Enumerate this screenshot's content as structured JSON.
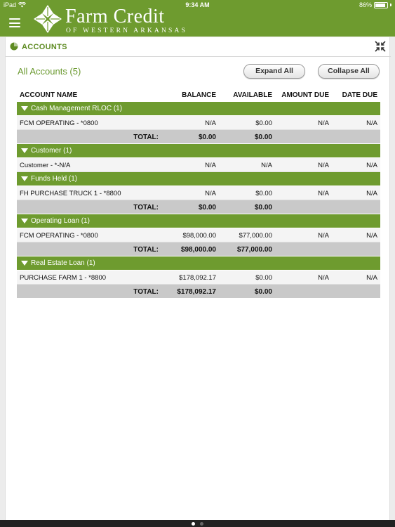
{
  "status_bar": {
    "device": "iPad",
    "time": "9:34 AM",
    "battery": "86%",
    "battery_level": 0.86
  },
  "brand": {
    "title": "Farm Credit",
    "subtitle": "OF WESTERN ARKANSAS"
  },
  "section": {
    "title": "ACCOUNTS"
  },
  "summary": {
    "title": "All Accounts (5)",
    "expand_label": "Expand All",
    "collapse_label": "Collapse All"
  },
  "columns": {
    "name": "ACCOUNT NAME",
    "balance": "BALANCE",
    "available": "AVAILABLE",
    "amount_due": "AMOUNT DUE",
    "date_due": "DATE DUE"
  },
  "total_label": "TOTAL:",
  "groups": [
    {
      "label": "Cash Management RLOC (1)",
      "rows": [
        {
          "name": "FCM OPERATING - *0800",
          "balance": "N/A",
          "available": "$0.00",
          "amount_due": "N/A",
          "date_due": "N/A"
        }
      ],
      "total": {
        "balance": "$0.00",
        "available": "$0.00"
      }
    },
    {
      "label": "Customer (1)",
      "rows": [
        {
          "name": "Customer - *-N/A",
          "balance": "N/A",
          "available": "N/A",
          "amount_due": "N/A",
          "date_due": "N/A"
        }
      ],
      "total": null
    },
    {
      "label": "Funds Held (1)",
      "rows": [
        {
          "name": "FH PURCHASE TRUCK 1 - *8800",
          "balance": "N/A",
          "available": "$0.00",
          "amount_due": "N/A",
          "date_due": "N/A"
        }
      ],
      "total": {
        "balance": "$0.00",
        "available": "$0.00"
      }
    },
    {
      "label": "Operating Loan (1)",
      "rows": [
        {
          "name": "FCM OPERATING - *0800",
          "balance": "$98,000.00",
          "available": "$77,000.00",
          "amount_due": "N/A",
          "date_due": "N/A"
        }
      ],
      "total": {
        "balance": "$98,000.00",
        "available": "$77,000.00"
      }
    },
    {
      "label": "Real Estate Loan (1)",
      "rows": [
        {
          "name": "PURCHASE FARM 1 - *8800",
          "balance": "$178,092.17",
          "available": "$0.00",
          "amount_due": "N/A",
          "date_due": "N/A"
        }
      ],
      "total": {
        "balance": "$178,092.17",
        "available": "$0.00"
      }
    }
  ],
  "colors": {
    "brand_green": "#6e9b2f",
    "accent_green": "#5e8b22"
  }
}
